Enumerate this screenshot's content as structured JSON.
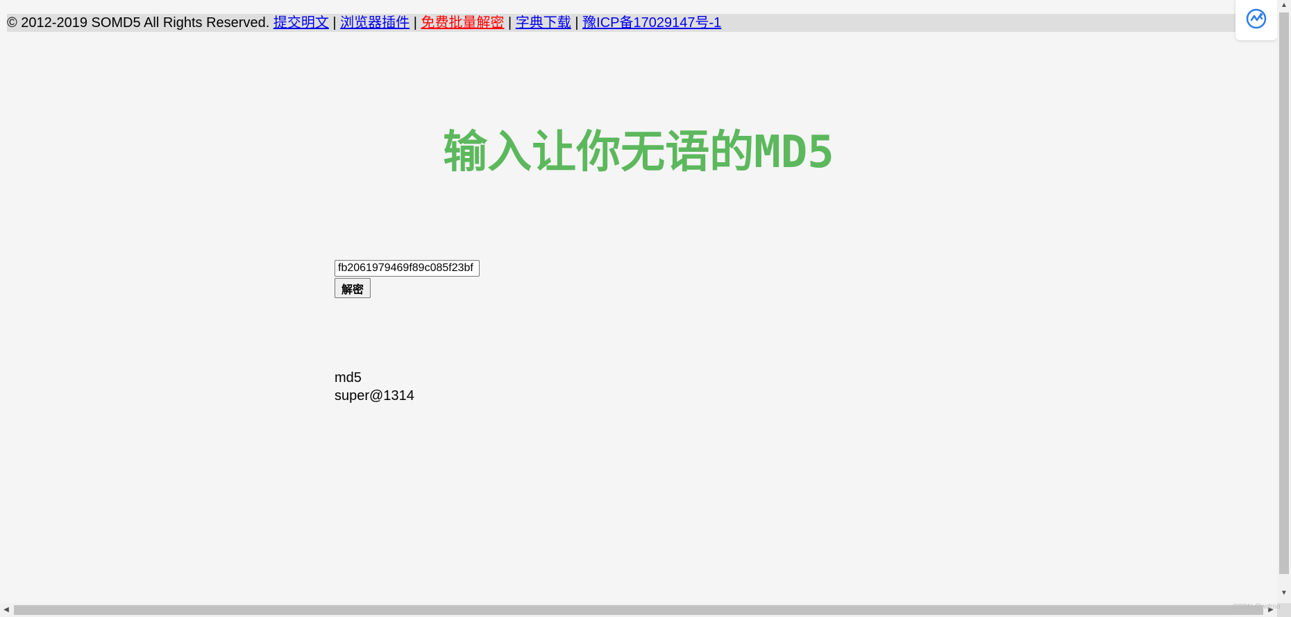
{
  "footer": {
    "copyright": "© 2012-2019 SOMD5 All Rights Reserved.",
    "separator": "|",
    "links": [
      {
        "label": "提交明文"
      },
      {
        "label": "浏览器插件"
      },
      {
        "label": "免费批量解密",
        "color": "#ff0000"
      },
      {
        "label": "字典下载"
      },
      {
        "label": "豫ICP备17029147号-1"
      }
    ]
  },
  "headline": "输入让你无语的MD5",
  "search": {
    "value": "fb2061979469f89c085f23bf",
    "button_label": "解密"
  },
  "result": {
    "type_label": "md5",
    "plaintext": "super@1314"
  },
  "extension_icon": "translate-extension-icon",
  "watermark": "CSDN @wdrno",
  "colors": {
    "headline": "#5cb85c",
    "link": "#0000ee",
    "link_highlight": "#ff0000",
    "background": "#f5f5f5",
    "footer_bar": "#dedede"
  }
}
